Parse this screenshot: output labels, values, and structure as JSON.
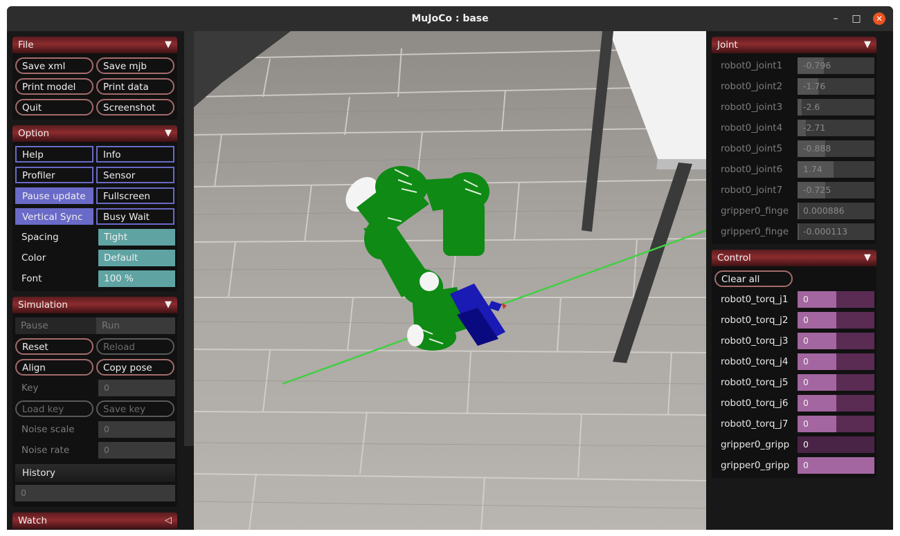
{
  "window": {
    "title": "MuJoCo : base",
    "min": "–",
    "max": "□",
    "close": "✕"
  },
  "file": {
    "title": "File",
    "arrow": "▼",
    "buttons": [
      "Save xml",
      "Save mjb",
      "Print model",
      "Print data",
      "Quit",
      "Screenshot"
    ]
  },
  "option": {
    "title": "Option",
    "arrow": "▼",
    "checks": [
      "Help",
      "Info",
      "Profiler",
      "Sensor",
      "Pause update",
      "Fullscreen",
      "Vertical Sync",
      "Busy Wait"
    ],
    "spacing_label": "Spacing",
    "spacing_value": "Tight",
    "color_label": "Color",
    "color_value": "Default",
    "font_label": "Font",
    "font_value": "100 %"
  },
  "simulation": {
    "title": "Simulation",
    "arrow": "▼",
    "pause": "Pause",
    "run": "Run",
    "reset": "Reset",
    "reload": "Reload",
    "align": "Align",
    "copy_pose": "Copy pose",
    "key_label": "Key",
    "key_value": "0",
    "load_key": "Load key",
    "save_key": "Save key",
    "noise_scale_label": "Noise scale",
    "noise_scale_value": "0",
    "noise_rate_label": "Noise rate",
    "noise_rate_value": "0",
    "history_label": "History",
    "history_value": "0"
  },
  "watch": {
    "title": "Watch",
    "arrow": "◁"
  },
  "joint": {
    "title": "Joint",
    "arrow": "▼",
    "rows": [
      {
        "name": "robot0_joint1",
        "value": "-0.796"
      },
      {
        "name": "robot0_joint2",
        "value": "-1.76"
      },
      {
        "name": "robot0_joint3",
        "value": "-2.6"
      },
      {
        "name": "robot0_joint4",
        "value": "-2.71"
      },
      {
        "name": "robot0_joint5",
        "value": "-0.888"
      },
      {
        "name": "robot0_joint6",
        "value": "1.74"
      },
      {
        "name": "robot0_joint7",
        "value": "-0.725"
      },
      {
        "name": "gripper0_finge",
        "value": "0.000886"
      },
      {
        "name": "gripper0_finge",
        "value": "-0.000113"
      }
    ]
  },
  "control": {
    "title": "Control",
    "arrow": "▼",
    "clear_all": "Clear all",
    "rows": [
      {
        "name": "robot0_torq_j1",
        "value": "0"
      },
      {
        "name": "robot0_torq_j2",
        "value": "0"
      },
      {
        "name": "robot0_torq_j3",
        "value": "0"
      },
      {
        "name": "robot0_torq_j4",
        "value": "0"
      },
      {
        "name": "robot0_torq_j5",
        "value": "0"
      },
      {
        "name": "robot0_torq_j6",
        "value": "0"
      },
      {
        "name": "robot0_torq_j7",
        "value": "0"
      },
      {
        "name": "gripper0_gripp",
        "value": "0"
      },
      {
        "name": "gripper0_gripp",
        "value": "0"
      }
    ]
  },
  "colors": {
    "section_header": "#8c2b2e",
    "check_border": "#6a6ac8",
    "select_bg": "#5fa3a3",
    "control_fill": "#a366a0",
    "robot": "#0f8a14",
    "gripper": "#1a1ab4"
  }
}
